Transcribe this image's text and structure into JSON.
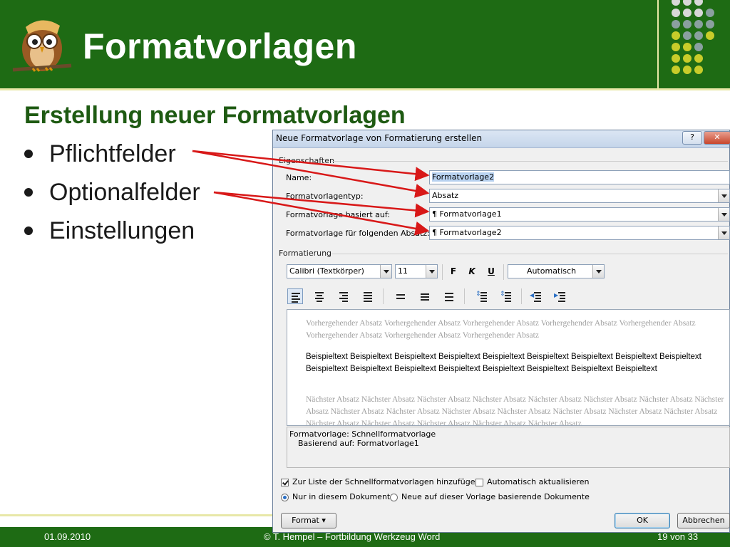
{
  "slide": {
    "title": "Formatvorlagen",
    "subtitle": "Erstellung neuer Formatvorlagen",
    "bullets": [
      "Pflichtfelder",
      "Optionalfelder",
      "Einstellungen"
    ]
  },
  "footer": {
    "date": "01.09.2010",
    "copyright": "© T. Hempel – Fortbildung Werkzeug Word",
    "page": "19 von 33"
  },
  "dialog": {
    "title": "Neue Formatvorlage von Formatierung erstellen",
    "help_label": "?",
    "close_label": "✕",
    "properties": {
      "heading": "Eigenschaften",
      "name_label": "Name:",
      "name_value": "Formatvorlage2",
      "type_label": "Formatvorlagentyp:",
      "type_value": "Absatz",
      "based_label": "Formatvorlage basiert auf:",
      "based_value": "¶ Formatvorlage1",
      "next_label": "Formatvorlage für folgenden Absatz:",
      "next_value": "¶ Formatvorlage2"
    },
    "formatting": {
      "heading": "Formatierung",
      "font": "Calibri (Textkörper)",
      "size": "11",
      "bold": "F",
      "italic": "K",
      "underline": "U",
      "color": "Automatisch"
    },
    "preview": {
      "previous": "Vorhergehender Absatz Vorhergehender Absatz Vorhergehender Absatz Vorhergehender Absatz Vorhergehender Absatz Vorhergehender Absatz Vorhergehender Absatz Vorhergehender Absatz",
      "sample": "Beispieltext Beispieltext Beispieltext Beispieltext Beispieltext Beispieltext Beispieltext Beispieltext Beispieltext Beispieltext Beispieltext Beispieltext Beispieltext Beispieltext Beispieltext Beispieltext Beispieltext",
      "next": "Nächster Absatz Nächster Absatz Nächster Absatz Nächster Absatz Nächster Absatz Nächster Absatz Nächster Absatz Nächster Absatz Nächster Absatz Nächster Absatz Nächster Absatz Nächster Absatz Nächster Absatz Nächster Absatz Nächster Absatz Nächster Absatz Nächster Absatz Nächster Absatz Nächster Absatz Nächster Absatz"
    },
    "description": {
      "line1": "Formatvorlage: Schnellformatvorlage",
      "line2": "Basierend auf: Formatvorlage1"
    },
    "options": {
      "add_to_quick": "Zur Liste der Schnellformatvorlagen hinzufügen",
      "add_to_quick_checked": true,
      "auto_update": "Automatisch aktualisieren",
      "auto_update_checked": false,
      "only_doc": "Nur in diesem Dokument",
      "only_doc_selected": true,
      "new_docs": "Neue auf dieser Vorlage basierende Dokumente"
    },
    "buttons": {
      "format": "Format ▾",
      "ok": "OK",
      "cancel": "Abbrechen"
    }
  },
  "colors": {
    "header_green": "#1e6b14",
    "accent_yellow": "#c8cc2a",
    "dot_grey": "#8aa0a0",
    "arrow_red": "#d81818"
  },
  "icons": [
    "owl-logo-icon",
    "align-left-icon",
    "align-center-icon",
    "align-right-icon",
    "justify-icon",
    "line-spacing-icon",
    "indent-icon"
  ]
}
